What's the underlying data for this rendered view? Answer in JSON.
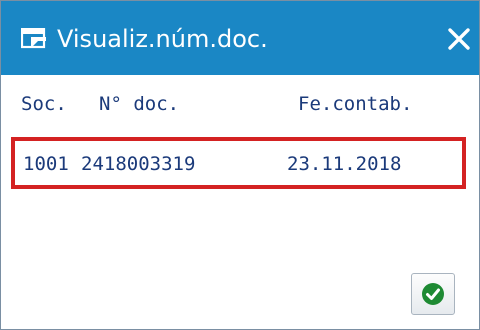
{
  "window": {
    "title": "Visualiz.núm.doc.",
    "icons": {
      "title_icon": "display-icon",
      "close_icon": "close-icon",
      "ok_icon": "checkmark-icon"
    }
  },
  "table": {
    "headers": [
      "Soc.",
      "N° doc.",
      "Fe.contab."
    ],
    "rows": [
      [
        "1001",
        "2418003319",
        "23.11.2018"
      ]
    ]
  },
  "colors": {
    "titlebar": "#1a87c5",
    "text": "#1b3a7a",
    "highlight_border": "#d42222",
    "ok_green": "#1e8a33"
  }
}
